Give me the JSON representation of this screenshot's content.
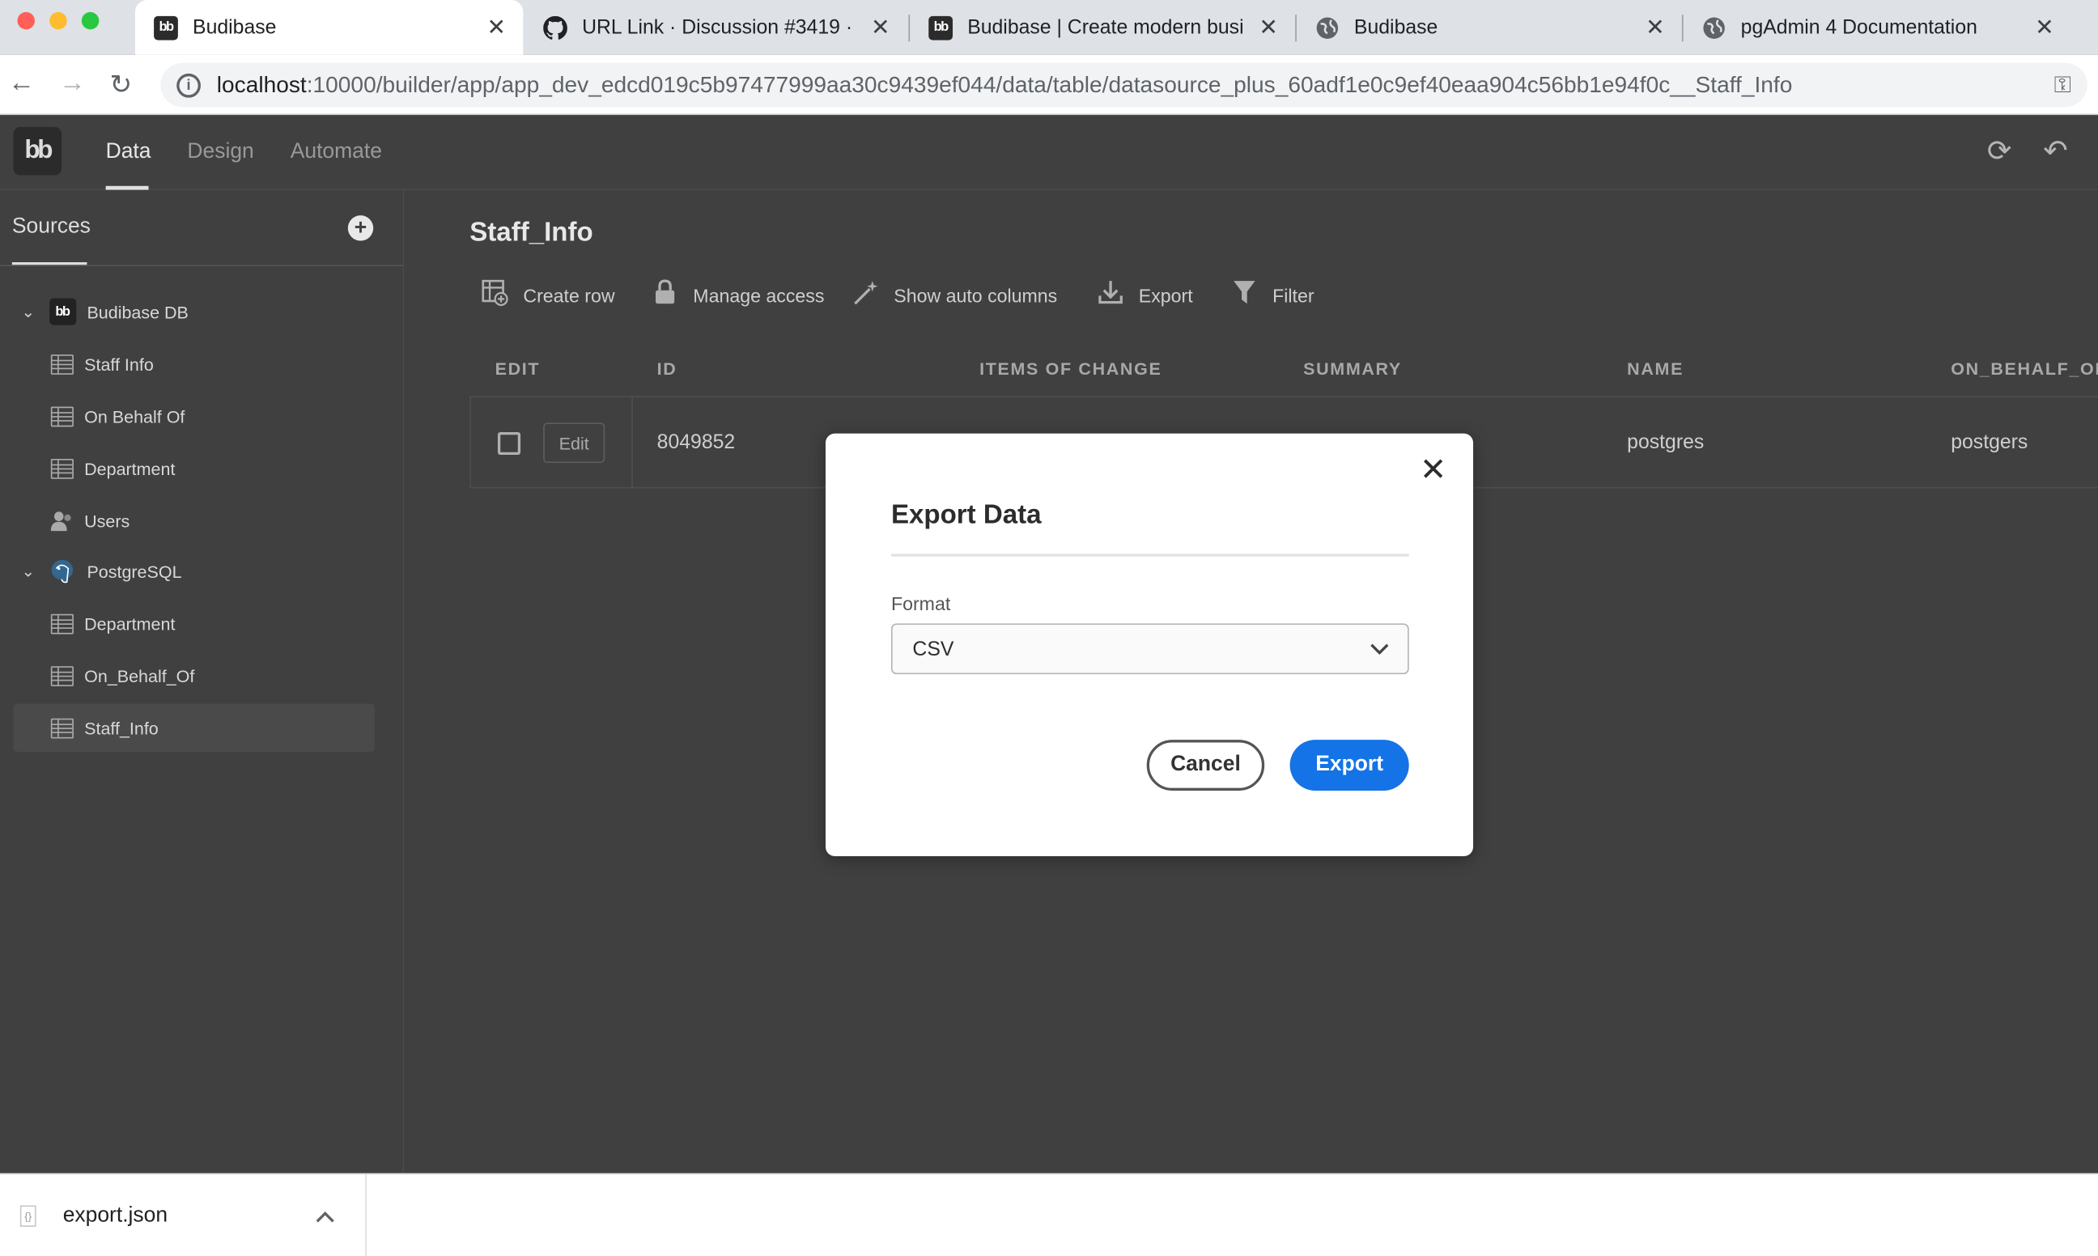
{
  "browser": {
    "tabs": [
      {
        "title": "Budibase",
        "active": true,
        "favicon": "budibase-icon"
      },
      {
        "title": "URL Link · Discussion #3419 ·",
        "active": false,
        "favicon": "github-icon"
      },
      {
        "title": "Budibase | Create modern busi",
        "active": false,
        "favicon": "budibase-icon"
      },
      {
        "title": "Budibase",
        "active": false,
        "favicon": "globe-icon"
      },
      {
        "title": "pgAdmin 4 Documentation",
        "active": false,
        "favicon": "globe-icon"
      }
    ],
    "url_host": "localhost",
    "url_rest": ":10000/builder/app/app_dev_edcd019c5b97477999aa30c9439ef044/data/table/datasource_plus_60adf1e0c9ef40eaa904c56bb1e94f0c__Staff_Info"
  },
  "app": {
    "logo": "bb",
    "nav": [
      "Data",
      "Design",
      "Automate"
    ],
    "active_nav": "Data"
  },
  "sidebar": {
    "title": "Sources",
    "datasources": [
      {
        "name": "Budibase DB",
        "icon": "budibase-icon",
        "tables": [
          "Staff Info",
          "On Behalf Of",
          "Department",
          "Users"
        ]
      },
      {
        "name": "PostgreSQL",
        "icon": "postgresql-icon",
        "tables": [
          "Department",
          "On_Behalf_Of",
          "Staff_Info"
        ]
      }
    ],
    "selected": "Staff_Info"
  },
  "main": {
    "title": "Staff_Info",
    "toolbar": [
      "Create row",
      "Manage access",
      "Show auto columns",
      "Export",
      "Filter"
    ],
    "columns": [
      "EDIT",
      "ID",
      "ITEMS OF CHANGE",
      "SUMMARY",
      "NAME",
      "ON_BEHALF_OF"
    ],
    "rows": [
      {
        "edit_label": "Edit",
        "id": "8049852",
        "items_of_change": "",
        "summary": "",
        "name": "postgres",
        "on_behalf_of": "postgers"
      }
    ]
  },
  "modal": {
    "title": "Export Data",
    "format_label": "Format",
    "format_value": "CSV",
    "cancel_label": "Cancel",
    "export_label": "Export"
  },
  "downloads": {
    "file_name": "export.json"
  },
  "colors": {
    "accent": "#1473e6",
    "app_bg": "#404040",
    "modal_bg": "#ffffff"
  }
}
